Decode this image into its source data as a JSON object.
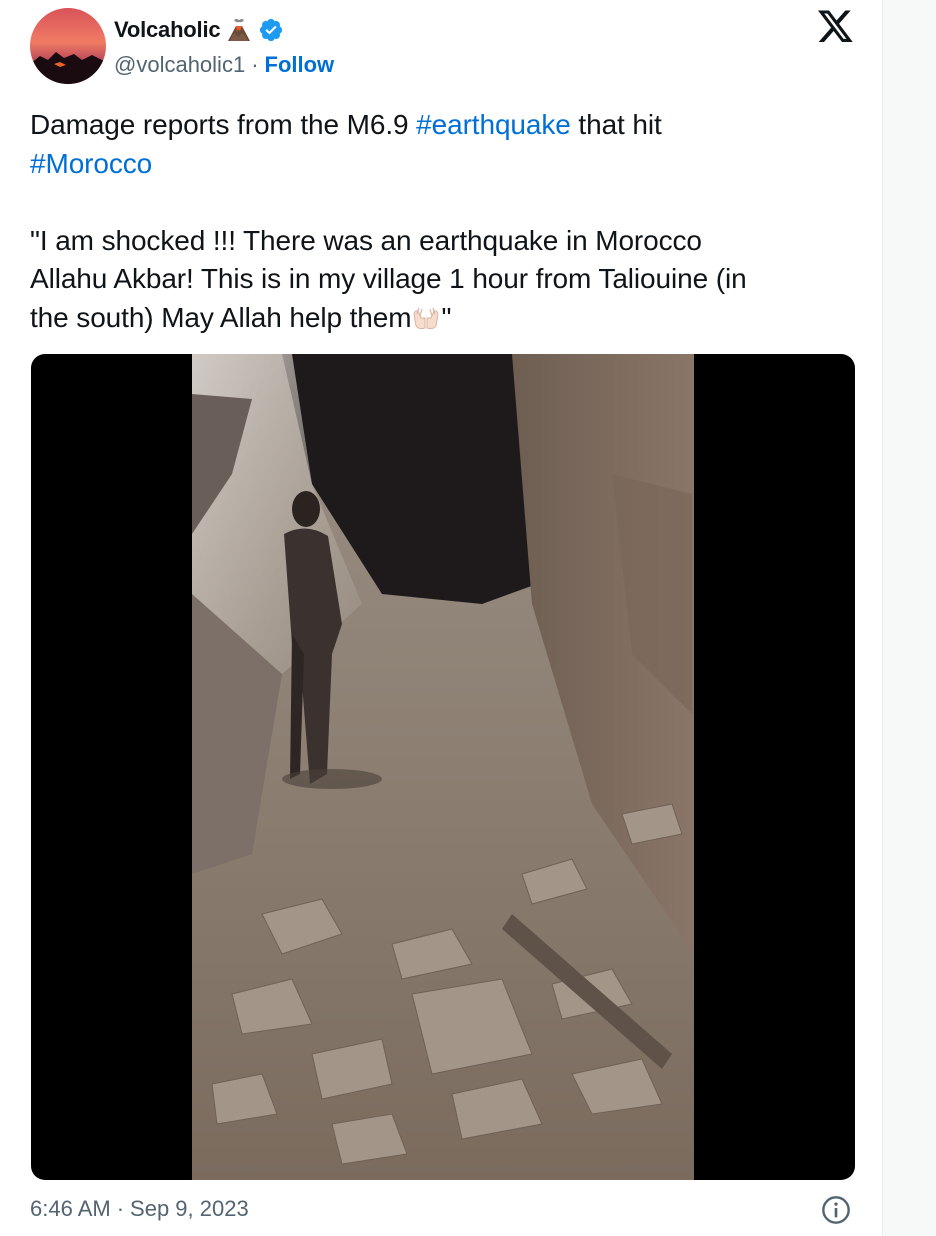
{
  "author": {
    "display_name": "Volcaholic",
    "handle": "@volcaholic1",
    "separator": "·",
    "follow_label": "Follow",
    "emoji_icon": "volcano-emoji",
    "verified_icon": "verified-badge-icon"
  },
  "tweet": {
    "line1_prefix": "Damage reports from the M6.9 ",
    "hashtag1": "#earthquake",
    "line1_suffix": " that hit",
    "hashtag2": "#Morocco",
    "quote_line1": "\"I am shocked !!! There was an earthquake in Morocco",
    "quote_line2": "Allahu Akbar! This is in my village 1 hour from Taliouine (in",
    "quote_line3_prefix": "the south) May Allah help them",
    "quote_emoji": "palms-up-together-emoji",
    "quote_line3_suffix": "\""
  },
  "media": {
    "type": "video",
    "content": "video-thumbnail"
  },
  "footer": {
    "time": "6:46 AM",
    "separator": "·",
    "date": "Sep 9, 2023",
    "info_icon": "info-icon"
  },
  "brand": {
    "logo": "x-logo-icon"
  },
  "colors": {
    "link": "#006fd6",
    "secondary_text": "#536471",
    "primary_text": "#0f1419",
    "verified": "#1d9bf0"
  }
}
